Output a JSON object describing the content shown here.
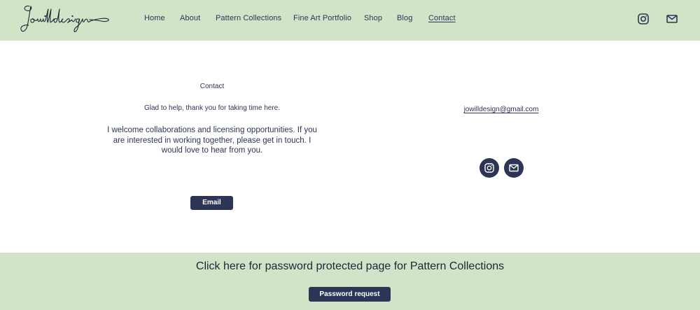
{
  "header": {
    "logo_text": "Jowilldesign",
    "nav": [
      {
        "label": "Home"
      },
      {
        "label": "About"
      },
      {
        "label": "Pattern Collections"
      },
      {
        "label": "Fine Art Portfolio"
      },
      {
        "label": "Shop"
      },
      {
        "label": "Blog"
      },
      {
        "label": "Contact",
        "active": true
      }
    ],
    "icons": [
      "instagram-icon",
      "mail-icon"
    ],
    "background": "#d1e4c8"
  },
  "main": {
    "title": "Contact",
    "subtitle": "Glad to help, thank you for taking time here.",
    "body": "I welcome collaborations and licensing opportunities. If you are interested in working together, please get in touch. I would love to hear from you.",
    "email_button": "Email",
    "email_address": "jowilldesign@gmail.com",
    "social_icons": [
      "instagram-icon",
      "mail-icon"
    ]
  },
  "footer": {
    "text": "Click here for password protected page for Pattern Collections",
    "button": "Password request"
  },
  "colors": {
    "navy": "#2c3556",
    "sage": "#d1e4c8",
    "white": "#ffffff"
  }
}
